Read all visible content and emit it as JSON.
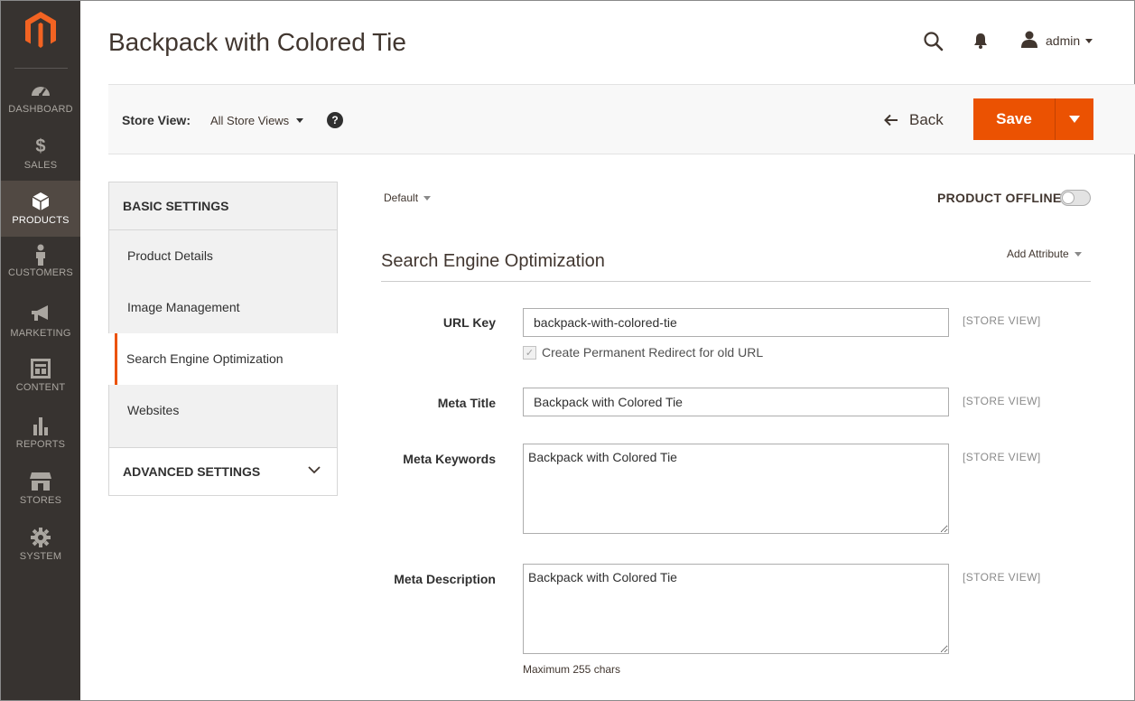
{
  "sidebar": {
    "items": [
      {
        "label": "DASHBOARD",
        "icon": "dashboard-icon"
      },
      {
        "label": "SALES",
        "icon": "dollar-icon"
      },
      {
        "label": "PRODUCTS",
        "icon": "cube-icon"
      },
      {
        "label": "CUSTOMERS",
        "icon": "person-icon"
      },
      {
        "label": "MARKETING",
        "icon": "megaphone-icon"
      },
      {
        "label": "CONTENT",
        "icon": "layout-icon"
      },
      {
        "label": "REPORTS",
        "icon": "bar-chart-icon"
      },
      {
        "label": "STORES",
        "icon": "storefront-icon"
      },
      {
        "label": "SYSTEM",
        "icon": "gear-icon"
      }
    ],
    "active": "PRODUCTS"
  },
  "header": {
    "title": "Backpack with Colored Tie",
    "user": "admin"
  },
  "actions": {
    "store_view_label": "Store View:",
    "store_view_value": "All Store Views",
    "help": "?",
    "back_label": "Back",
    "save_label": "Save"
  },
  "tabs": {
    "basic_title": "BASIC SETTINGS",
    "items": [
      "Product Details",
      "Image Management",
      "Search Engine Optimization",
      "Websites"
    ],
    "active": "Search Engine Optimization",
    "advanced_title": "ADVANCED SETTINGS"
  },
  "form": {
    "scope_switcher": "Default",
    "offline_label": "PRODUCT OFFLINE",
    "section_title": "Search Engine Optimization",
    "add_attribute": "Add Attribute",
    "scope_tag": "[STORE VIEW]",
    "url_key": {
      "label": "URL Key",
      "value": "backpack-with-colored-tie"
    },
    "redirect_label": "Create Permanent Redirect for old URL",
    "meta_title": {
      "label": "Meta Title",
      "value": "Backpack with Colored Tie"
    },
    "meta_keywords": {
      "label": "Meta Keywords",
      "value": "Backpack with Colored Tie"
    },
    "meta_description": {
      "label": "Meta Description",
      "value": "Backpack with Colored Tie"
    },
    "max_note": "Maximum 255 chars"
  },
  "colors": {
    "accent": "#eb5202",
    "sidebar_bg": "#373330",
    "sidebar_active": "#514943"
  }
}
